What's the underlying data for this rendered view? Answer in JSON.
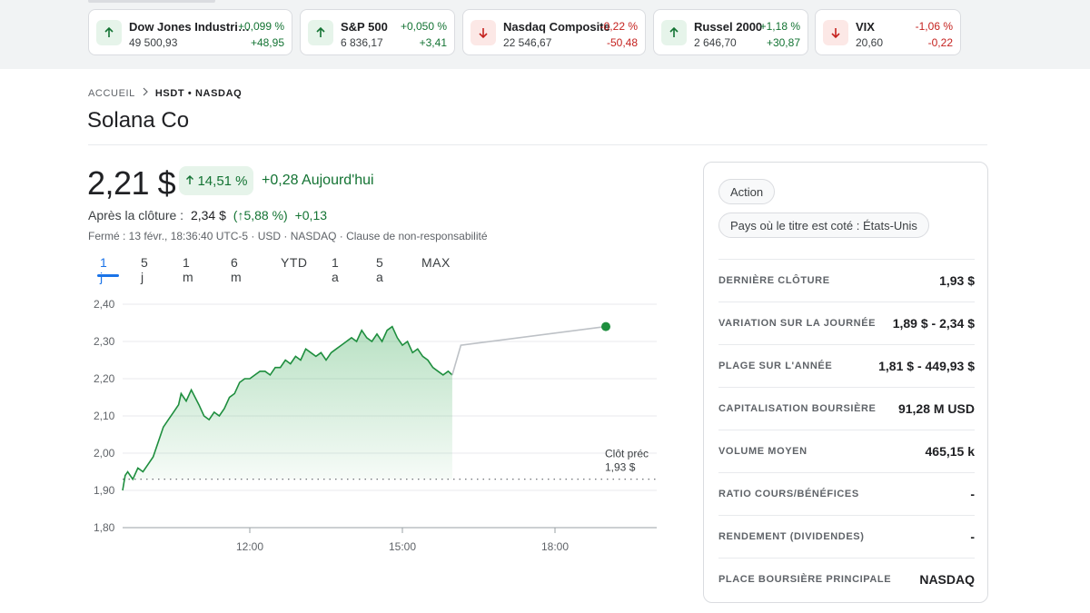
{
  "tickers": [
    {
      "name": "Dow Jones Industri…",
      "value": "49 500,93",
      "pct": "+0,099 %",
      "change": "+48,95",
      "dir": "up"
    },
    {
      "name": "S&P 500",
      "value": "6 836,17",
      "pct": "+0,050 %",
      "change": "+3,41",
      "dir": "up"
    },
    {
      "name": "Nasdaq Composite",
      "value": "22 546,67",
      "pct": "-0,22 %",
      "change": "-50,48",
      "dir": "down"
    },
    {
      "name": "Russel 2000",
      "value": "2 646,70",
      "pct": "+1,18 %",
      "change": "+30,87",
      "dir": "up"
    },
    {
      "name": "VIX",
      "value": "20,60",
      "pct": "-1,06 %",
      "change": "-0,22",
      "dir": "down"
    }
  ],
  "breadcrumb": {
    "home": "ACCUEIL",
    "current": "HSDT • NASDAQ"
  },
  "title": "Solana Co",
  "quote": {
    "price": "2,21 $",
    "pct_change": "14,51 %",
    "day_change": "+0,28 Aujourd'hui",
    "after_hours_label": "Après la clôture :",
    "after_hours_price": "2,34 $",
    "after_hours_pct": "(↑5,88 %)",
    "after_hours_change": "+0,13",
    "status_line": "Fermé : 13 févr., 18:36:40 UTC-5 · USD · NASDAQ · Clause de non-responsabilité"
  },
  "ranges": [
    "1 j",
    "5 j",
    "1 m",
    "6 m",
    "YTD",
    "1 a",
    "5 a",
    "MAX"
  ],
  "active_range": "1 j",
  "chart_data": {
    "type": "line",
    "y_ticks": [
      "2,40",
      "2,30",
      "2,20",
      "2,10",
      "2,00",
      "1,90",
      "1,80"
    ],
    "ylim": [
      1.8,
      2.4
    ],
    "x_ticks": [
      {
        "label": "12:00",
        "t": 12
      },
      {
        "label": "15:00",
        "t": 15
      },
      {
        "label": "18:00",
        "t": 18
      }
    ],
    "xlim": [
      9.5,
      20.0
    ],
    "previous_close": 1.93,
    "previous_close_label": "Clôt préc",
    "previous_close_value": "1,93 $",
    "series": [
      {
        "session": "regular",
        "points": [
          [
            9.5,
            1.9
          ],
          [
            9.55,
            1.94
          ],
          [
            9.6,
            1.95
          ],
          [
            9.7,
            1.93
          ],
          [
            9.8,
            1.96
          ],
          [
            9.9,
            1.95
          ],
          [
            10.0,
            1.97
          ],
          [
            10.1,
            1.99
          ],
          [
            10.2,
            2.03
          ],
          [
            10.3,
            2.07
          ],
          [
            10.4,
            2.09
          ],
          [
            10.5,
            2.11
          ],
          [
            10.6,
            2.13
          ],
          [
            10.65,
            2.16
          ],
          [
            10.75,
            2.14
          ],
          [
            10.85,
            2.17
          ],
          [
            11.0,
            2.13
          ],
          [
            11.1,
            2.1
          ],
          [
            11.2,
            2.09
          ],
          [
            11.3,
            2.11
          ],
          [
            11.4,
            2.1
          ],
          [
            11.5,
            2.12
          ],
          [
            11.6,
            2.15
          ],
          [
            11.7,
            2.16
          ],
          [
            11.8,
            2.19
          ],
          [
            11.9,
            2.2
          ],
          [
            12.0,
            2.2
          ],
          [
            12.1,
            2.21
          ],
          [
            12.2,
            2.22
          ],
          [
            12.3,
            2.22
          ],
          [
            12.4,
            2.21
          ],
          [
            12.5,
            2.23
          ],
          [
            12.6,
            2.23
          ],
          [
            12.7,
            2.25
          ],
          [
            12.8,
            2.24
          ],
          [
            12.9,
            2.26
          ],
          [
            13.0,
            2.25
          ],
          [
            13.1,
            2.28
          ],
          [
            13.2,
            2.27
          ],
          [
            13.3,
            2.26
          ],
          [
            13.4,
            2.27
          ],
          [
            13.5,
            2.25
          ],
          [
            13.6,
            2.27
          ],
          [
            13.7,
            2.28
          ],
          [
            13.8,
            2.29
          ],
          [
            13.9,
            2.3
          ],
          [
            14.0,
            2.31
          ],
          [
            14.1,
            2.3
          ],
          [
            14.2,
            2.33
          ],
          [
            14.3,
            2.31
          ],
          [
            14.4,
            2.3
          ],
          [
            14.5,
            2.32
          ],
          [
            14.6,
            2.3
          ],
          [
            14.7,
            2.33
          ],
          [
            14.8,
            2.34
          ],
          [
            14.9,
            2.31
          ],
          [
            15.0,
            2.29
          ],
          [
            15.1,
            2.3
          ],
          [
            15.2,
            2.27
          ],
          [
            15.3,
            2.28
          ],
          [
            15.4,
            2.26
          ],
          [
            15.5,
            2.25
          ],
          [
            15.6,
            2.23
          ],
          [
            15.7,
            2.22
          ],
          [
            15.8,
            2.21
          ],
          [
            15.9,
            2.22
          ],
          [
            15.98,
            2.21
          ]
        ]
      },
      {
        "session": "after_hours",
        "points": [
          [
            15.98,
            2.21
          ],
          [
            16.15,
            2.29
          ],
          [
            19.0,
            2.34
          ]
        ]
      }
    ]
  },
  "stats": {
    "chips": [
      "Action",
      "Pays où le titre est coté : États-Unis"
    ],
    "rows": [
      {
        "label": "DERNIÈRE CLÔTURE",
        "value": "1,93 $"
      },
      {
        "label": "VARIATION SUR LA JOURNÉE",
        "value": "1,89 $ - 2,34 $"
      },
      {
        "label": "PLAGE SUR L'ANNÉE",
        "value": "1,81 $ - 449,93 $"
      },
      {
        "label": "CAPITALISATION BOURSIÈRE",
        "value": "91,28 M USD"
      },
      {
        "label": "VOLUME MOYEN",
        "value": "465,15 k"
      },
      {
        "label": "RATIO COURS/BÉNÉFICES",
        "value": "-"
      },
      {
        "label": "RENDEMENT (DIVIDENDES)",
        "value": "-"
      },
      {
        "label": "PLACE BOURSIÈRE PRINCIPALE",
        "value": "NASDAQ"
      }
    ]
  },
  "colors": {
    "positive": "#137333",
    "negative": "#c5221f",
    "line": "#1e8e3e",
    "accent": "#1a73e8",
    "after_hours_line": "#bdc1c6"
  }
}
